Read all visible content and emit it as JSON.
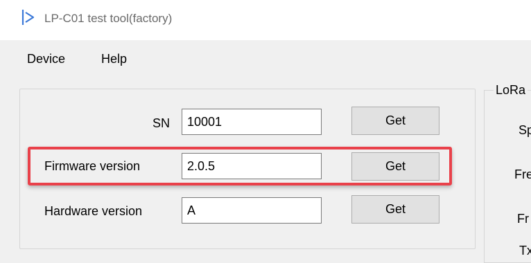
{
  "window": {
    "title": "LP-C01 test tool(factory)",
    "icon": "app-logo-icon"
  },
  "menu": {
    "items": [
      {
        "label": "Device"
      },
      {
        "label": "Help"
      }
    ]
  },
  "device_info": {
    "rows": [
      {
        "label": "SN",
        "value": "10001",
        "button": "Get"
      },
      {
        "label": "Firmware version",
        "value": "2.0.5",
        "button": "Get"
      },
      {
        "label": "Hardware version",
        "value": "A",
        "button": "Get"
      }
    ]
  },
  "lora_group": {
    "title": "LoRa",
    "labels": [
      "Sp",
      "Fre",
      "Fr",
      "Tx"
    ]
  },
  "highlight": {
    "color": "#e9414a",
    "target": "firmware-version-row"
  }
}
